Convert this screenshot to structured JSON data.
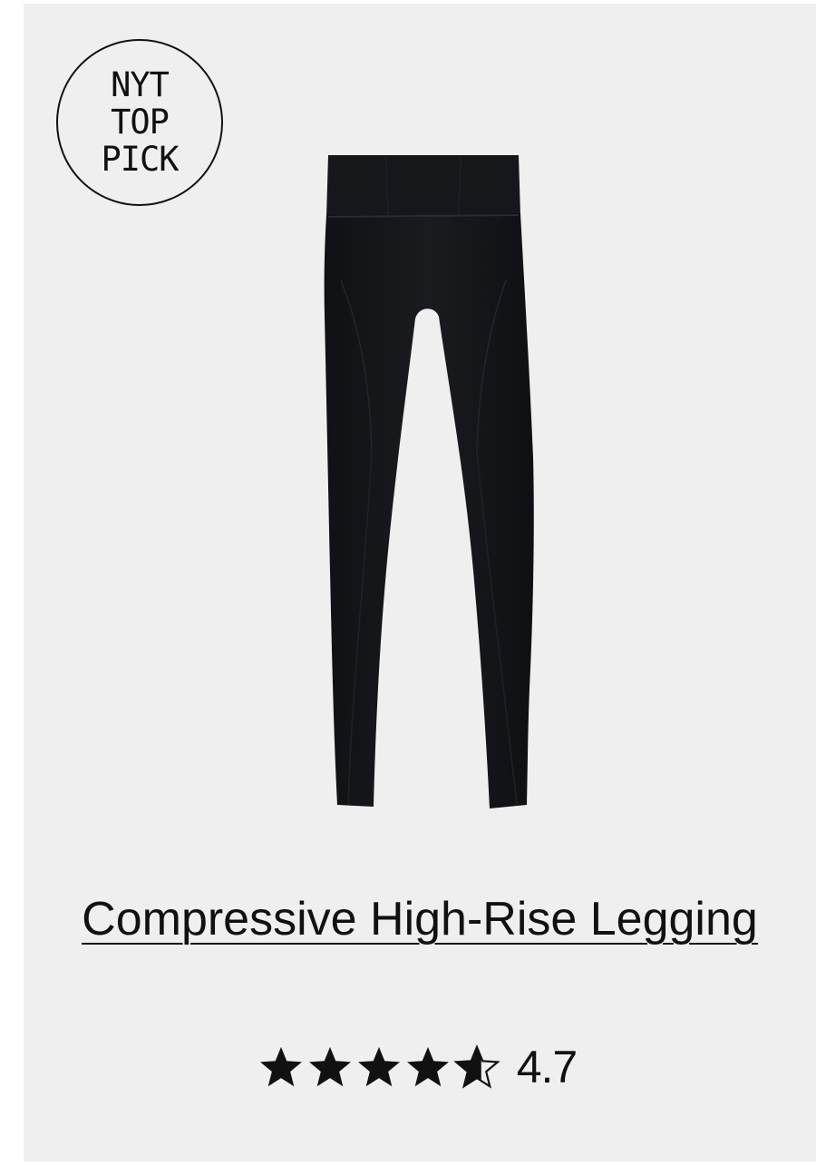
{
  "badge": {
    "line1": "NYT",
    "line2": "TOP",
    "line3": "PICK"
  },
  "product": {
    "title": "Compressive High-Rise Legging",
    "image_icon": "leggings-image",
    "rating_value": "4.7",
    "rating": 4.7,
    "rating_max": 5
  },
  "colors": {
    "card_background": "#efefef",
    "text": "#111111",
    "product": "#141518"
  }
}
